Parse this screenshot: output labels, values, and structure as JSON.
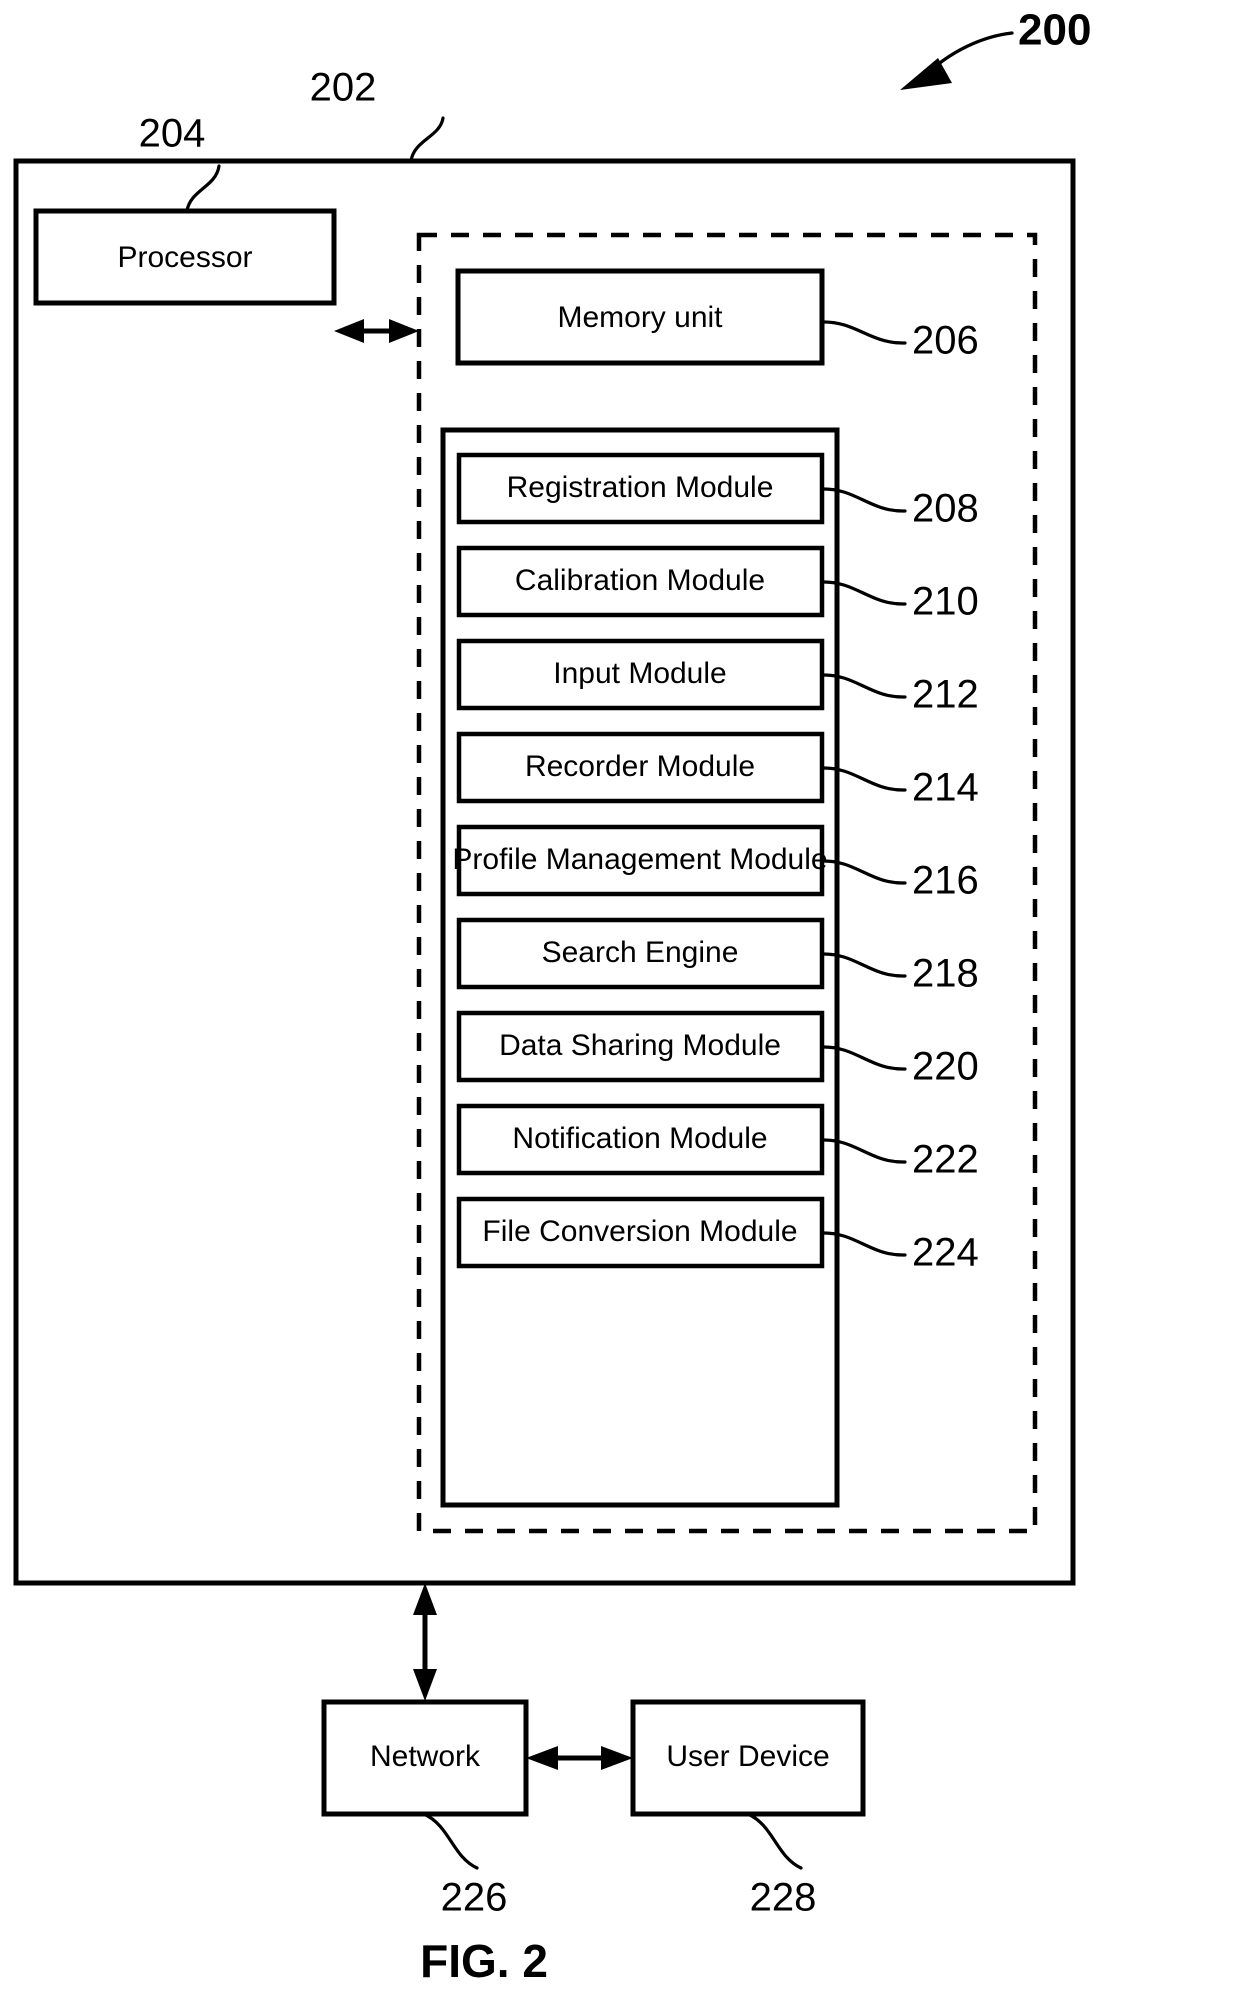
{
  "figure": {
    "caption": "FIG. 2",
    "system_ref": "200"
  },
  "refs": {
    "system_block": "202",
    "processor": "204",
    "memory_unit": "206",
    "registration_module": "208",
    "calibration_module": "210",
    "input_module": "212",
    "recorder_module": "214",
    "profile_management_module": "216",
    "search_engine": "218",
    "data_sharing_module": "220",
    "notification_module": "222",
    "file_conversion_module": "224",
    "network": "226",
    "user_device": "228"
  },
  "blocks": {
    "processor": "Processor",
    "memory_unit": "Memory unit",
    "network": "Network",
    "user_device": "User Device"
  },
  "modules": [
    {
      "label": "Registration Module",
      "ref": "208"
    },
    {
      "label": "Calibration Module",
      "ref": "210"
    },
    {
      "label": "Input Module",
      "ref": "212"
    },
    {
      "label": "Recorder Module",
      "ref": "214"
    },
    {
      "label": "Profile Management Module",
      "ref": "216"
    },
    {
      "label": "Search Engine",
      "ref": "218"
    },
    {
      "label": "Data Sharing Module",
      "ref": "220"
    },
    {
      "label": "Notification Module",
      "ref": "222"
    },
    {
      "label": "File Conversion Module",
      "ref": "224"
    }
  ],
  "colors": {
    "stroke": "#000000",
    "background": "#ffffff"
  }
}
